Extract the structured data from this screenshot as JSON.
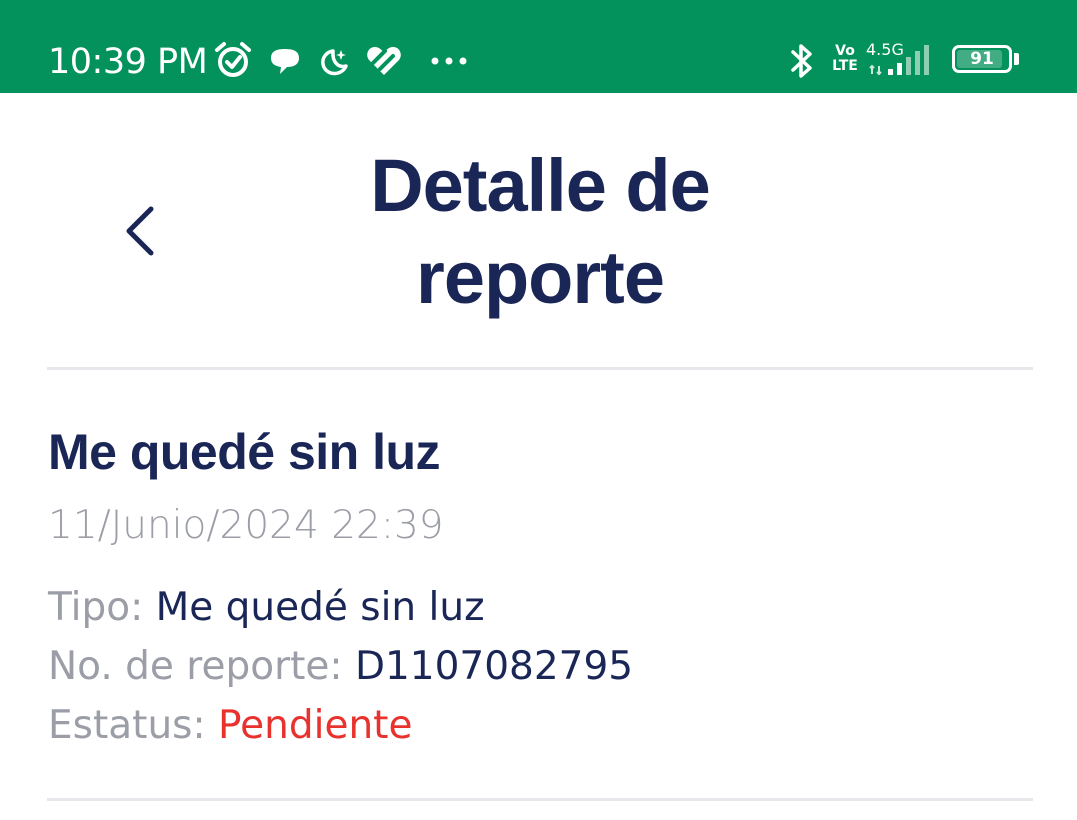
{
  "status_bar": {
    "time": "10:39 PM",
    "network_top": "Vo",
    "network_bottom": "LTE",
    "generation": "4.5G",
    "battery": "91",
    "battery_level": 0.91,
    "icons": [
      "alarm-icon",
      "chat-bubble-icon",
      "moon-icon",
      "heart-icon",
      "more-dots-icon",
      "bluetooth-icon",
      "signal-icon",
      "battery-icon"
    ],
    "color": "#03925c"
  },
  "header": {
    "title_line1": "Detalle de",
    "title_line2": "reporte",
    "back_icon": "chevron-left-icon"
  },
  "report": {
    "title": "Me quedé sin luz",
    "date": "11/Junio/2024 22:39",
    "fields": [
      {
        "label": "Tipo:",
        "value": "Me quedé sin luz"
      },
      {
        "label": "No. de reporte:",
        "value": "D1107082795"
      },
      {
        "label": "Estatus:",
        "value": "Pendiente"
      }
    ],
    "status_color": "#e8322e"
  },
  "colors": {
    "text_primary": "#1a2656",
    "text_secondary": "#9b9ea6",
    "divider": "#e6e8ec"
  }
}
